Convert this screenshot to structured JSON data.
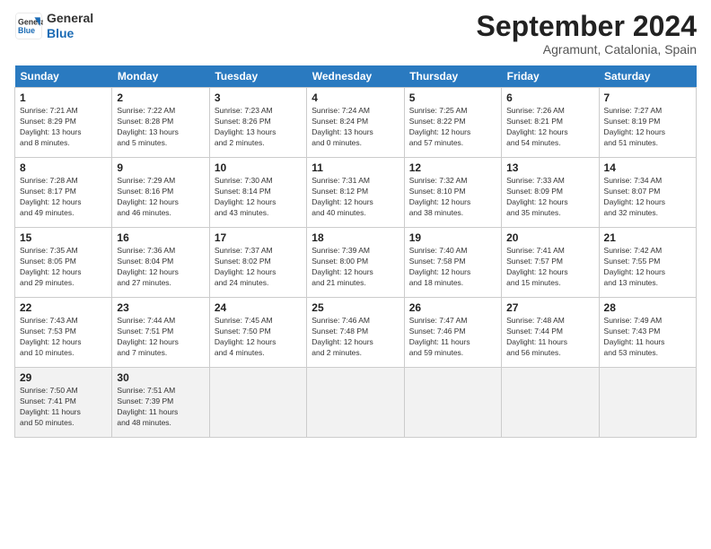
{
  "logo": {
    "line1": "General",
    "line2": "Blue"
  },
  "title": "September 2024",
  "subtitle": "Agramunt, Catalonia, Spain",
  "weekdays": [
    "Sunday",
    "Monday",
    "Tuesday",
    "Wednesday",
    "Thursday",
    "Friday",
    "Saturday"
  ],
  "days": [
    {
      "num": "",
      "info": ""
    },
    {
      "num": "",
      "info": ""
    },
    {
      "num": "",
      "info": ""
    },
    {
      "num": "",
      "info": ""
    },
    {
      "num": "",
      "info": ""
    },
    {
      "num": "",
      "info": ""
    },
    {
      "num": "",
      "info": ""
    },
    {
      "num": "1",
      "info": "Sunrise: 7:21 AM\nSunset: 8:29 PM\nDaylight: 13 hours\nand 8 minutes."
    },
    {
      "num": "2",
      "info": "Sunrise: 7:22 AM\nSunset: 8:28 PM\nDaylight: 13 hours\nand 5 minutes."
    },
    {
      "num": "3",
      "info": "Sunrise: 7:23 AM\nSunset: 8:26 PM\nDaylight: 13 hours\nand 2 minutes."
    },
    {
      "num": "4",
      "info": "Sunrise: 7:24 AM\nSunset: 8:24 PM\nDaylight: 13 hours\nand 0 minutes."
    },
    {
      "num": "5",
      "info": "Sunrise: 7:25 AM\nSunset: 8:22 PM\nDaylight: 12 hours\nand 57 minutes."
    },
    {
      "num": "6",
      "info": "Sunrise: 7:26 AM\nSunset: 8:21 PM\nDaylight: 12 hours\nand 54 minutes."
    },
    {
      "num": "7",
      "info": "Sunrise: 7:27 AM\nSunset: 8:19 PM\nDaylight: 12 hours\nand 51 minutes."
    },
    {
      "num": "8",
      "info": "Sunrise: 7:28 AM\nSunset: 8:17 PM\nDaylight: 12 hours\nand 49 minutes."
    },
    {
      "num": "9",
      "info": "Sunrise: 7:29 AM\nSunset: 8:16 PM\nDaylight: 12 hours\nand 46 minutes."
    },
    {
      "num": "10",
      "info": "Sunrise: 7:30 AM\nSunset: 8:14 PM\nDaylight: 12 hours\nand 43 minutes."
    },
    {
      "num": "11",
      "info": "Sunrise: 7:31 AM\nSunset: 8:12 PM\nDaylight: 12 hours\nand 40 minutes."
    },
    {
      "num": "12",
      "info": "Sunrise: 7:32 AM\nSunset: 8:10 PM\nDaylight: 12 hours\nand 38 minutes."
    },
    {
      "num": "13",
      "info": "Sunrise: 7:33 AM\nSunset: 8:09 PM\nDaylight: 12 hours\nand 35 minutes."
    },
    {
      "num": "14",
      "info": "Sunrise: 7:34 AM\nSunset: 8:07 PM\nDaylight: 12 hours\nand 32 minutes."
    },
    {
      "num": "15",
      "info": "Sunrise: 7:35 AM\nSunset: 8:05 PM\nDaylight: 12 hours\nand 29 minutes."
    },
    {
      "num": "16",
      "info": "Sunrise: 7:36 AM\nSunset: 8:04 PM\nDaylight: 12 hours\nand 27 minutes."
    },
    {
      "num": "17",
      "info": "Sunrise: 7:37 AM\nSunset: 8:02 PM\nDaylight: 12 hours\nand 24 minutes."
    },
    {
      "num": "18",
      "info": "Sunrise: 7:39 AM\nSunset: 8:00 PM\nDaylight: 12 hours\nand 21 minutes."
    },
    {
      "num": "19",
      "info": "Sunrise: 7:40 AM\nSunset: 7:58 PM\nDaylight: 12 hours\nand 18 minutes."
    },
    {
      "num": "20",
      "info": "Sunrise: 7:41 AM\nSunset: 7:57 PM\nDaylight: 12 hours\nand 15 minutes."
    },
    {
      "num": "21",
      "info": "Sunrise: 7:42 AM\nSunset: 7:55 PM\nDaylight: 12 hours\nand 13 minutes."
    },
    {
      "num": "22",
      "info": "Sunrise: 7:43 AM\nSunset: 7:53 PM\nDaylight: 12 hours\nand 10 minutes."
    },
    {
      "num": "23",
      "info": "Sunrise: 7:44 AM\nSunset: 7:51 PM\nDaylight: 12 hours\nand 7 minutes."
    },
    {
      "num": "24",
      "info": "Sunrise: 7:45 AM\nSunset: 7:50 PM\nDaylight: 12 hours\nand 4 minutes."
    },
    {
      "num": "25",
      "info": "Sunrise: 7:46 AM\nSunset: 7:48 PM\nDaylight: 12 hours\nand 2 minutes."
    },
    {
      "num": "26",
      "info": "Sunrise: 7:47 AM\nSunset: 7:46 PM\nDaylight: 11 hours\nand 59 minutes."
    },
    {
      "num": "27",
      "info": "Sunrise: 7:48 AM\nSunset: 7:44 PM\nDaylight: 11 hours\nand 56 minutes."
    },
    {
      "num": "28",
      "info": "Sunrise: 7:49 AM\nSunset: 7:43 PM\nDaylight: 11 hours\nand 53 minutes."
    },
    {
      "num": "29",
      "info": "Sunrise: 7:50 AM\nSunset: 7:41 PM\nDaylight: 11 hours\nand 50 minutes."
    },
    {
      "num": "30",
      "info": "Sunrise: 7:51 AM\nSunset: 7:39 PM\nDaylight: 11 hours\nand 48 minutes."
    },
    {
      "num": "",
      "info": ""
    },
    {
      "num": "",
      "info": ""
    },
    {
      "num": "",
      "info": ""
    },
    {
      "num": "",
      "info": ""
    },
    {
      "num": "",
      "info": ""
    }
  ]
}
